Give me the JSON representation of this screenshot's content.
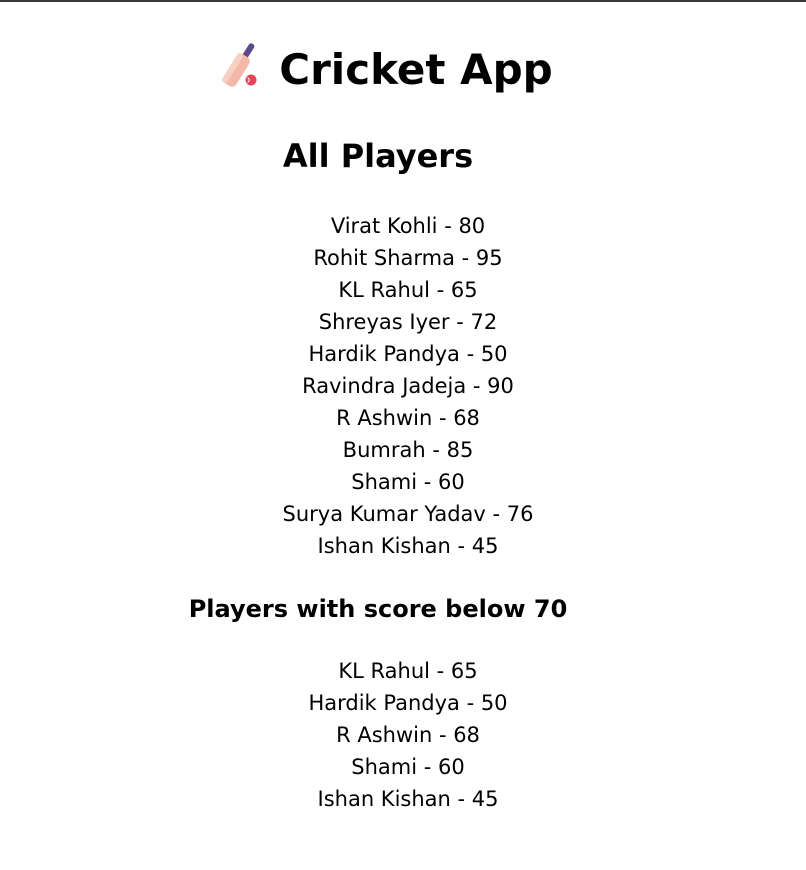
{
  "app": {
    "title": "Cricket App",
    "title_icon": "cricket-bat-icon",
    "icon_colors": {
      "handle": "#5b4a8a",
      "blade": "#f2b8a8",
      "ball": "#e8445a"
    }
  },
  "all_players": {
    "heading": "All Players",
    "players": [
      "Virat Kohli - 80",
      "Rohit Sharma - 95",
      "KL Rahul - 65",
      "Shreyas Iyer - 72",
      "Hardik Pandya - 50",
      "Ravindra Jadeja - 90",
      "R Ashwin - 68",
      "Bumrah - 85",
      "Shami - 60",
      "Surya Kumar Yadav - 76",
      "Ishan Kishan - 45"
    ]
  },
  "below_70": {
    "heading": "Players with score below 70",
    "players": [
      "KL Rahul - 65",
      "Hardik Pandya - 50",
      "R Ashwin - 68",
      "Shami - 60",
      "Ishan Kishan - 45"
    ]
  }
}
